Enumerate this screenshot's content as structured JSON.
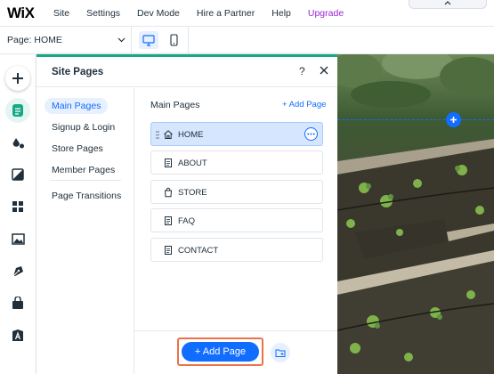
{
  "topbar": {
    "logo": "WiX",
    "menu": [
      "Site",
      "Settings",
      "Dev Mode",
      "Hire a Partner",
      "Help",
      "Upgrade"
    ]
  },
  "subbar": {
    "page_select_label": "Page: HOME",
    "devices": [
      "desktop-icon",
      "mobile-icon"
    ]
  },
  "rail": {
    "icons": [
      "add-elements-icon",
      "pages-icon",
      "design-icon",
      "add-section-icon",
      "apps-icon",
      "media-icon",
      "blog-icon",
      "business-icon",
      "content-manager-icon"
    ]
  },
  "panel": {
    "title": "Site Pages",
    "help": "?",
    "nav": [
      "Main Pages",
      "Signup & Login",
      "Store Pages",
      "Member Pages",
      "Page Transitions"
    ],
    "content_title": "Main Pages",
    "add_link": "+ Add Page",
    "pages": [
      {
        "label": "HOME",
        "icon": "home-icon",
        "selected": true
      },
      {
        "label": "ABOUT",
        "icon": "page-icon",
        "selected": false
      },
      {
        "label": "STORE",
        "icon": "store-bag-icon",
        "selected": false
      },
      {
        "label": "FAQ",
        "icon": "page-icon",
        "selected": false
      },
      {
        "label": "CONTACT",
        "icon": "page-icon",
        "selected": false
      }
    ],
    "add_button": "+ Add Page"
  },
  "colors": {
    "accent": "#116dff",
    "panel_border": "#17a887",
    "upgrade": "#9a27d5",
    "highlight": "#ef6f49"
  }
}
